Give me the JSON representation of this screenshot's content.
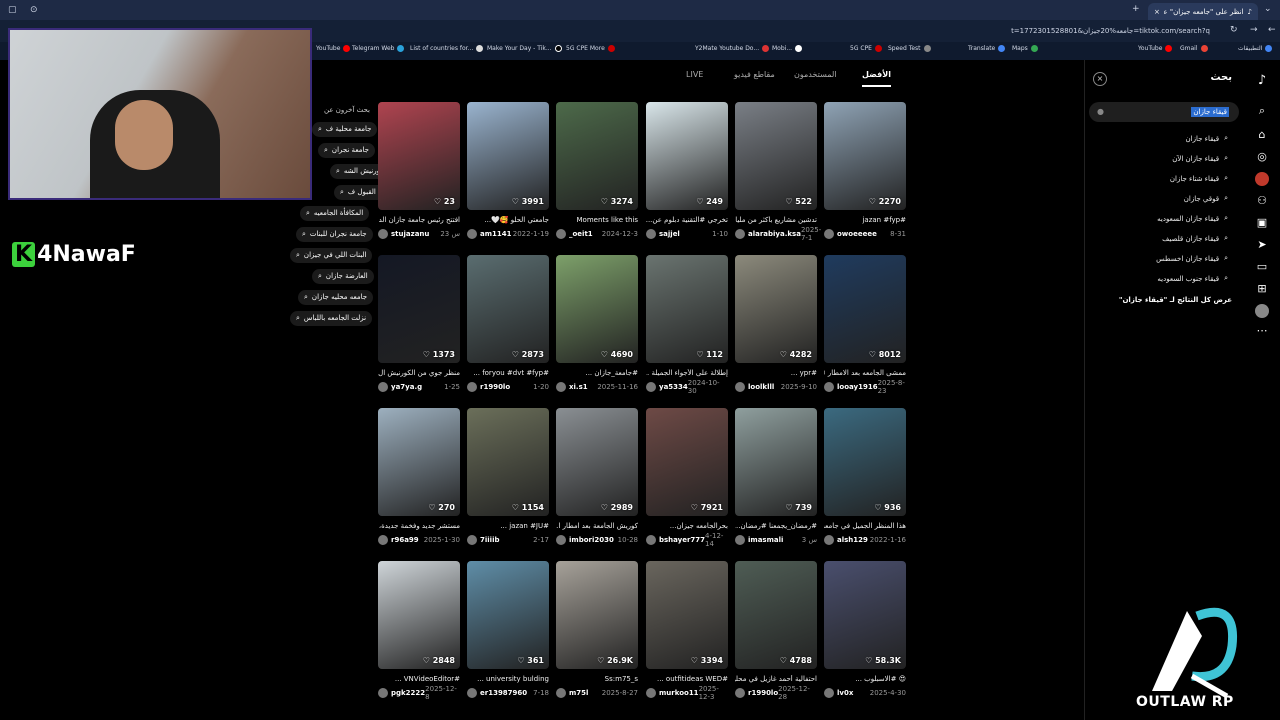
{
  "browser": {
    "tab_title": "انظر على \"جامعه جيزان\" على...",
    "url": "tiktok.com/search?q=جامعه%20جيزان&t=1772301528801",
    "bookmarks": [
      "التطبيقات",
      "Gmail",
      "YouTube",
      "Maps",
      "Translate",
      "Speed Test",
      "5G CPE",
      "Mobi...",
      "Y2Mate Youtube Do...",
      "5G CPE More",
      "Make Your Day - Tik...",
      "List of countries for...",
      "Telegram Web",
      "YouTube"
    ]
  },
  "streamer": {
    "logo_letter": "K",
    "logo_text": "4NawaF",
    "brand": "OUTLAW RP"
  },
  "search_panel": {
    "title": "بحث",
    "query": "قيقاء جازان",
    "suggestions": [
      "قيقاء جازان",
      "قيقاء جازان الآن",
      "قيقاء شتاء جازان",
      "قوقي جازان",
      "قيقاء جازان السعوديه",
      "قيقاء جازان قلصيف",
      "قيقاء جازان اخسطس",
      "قيقاء جنوب السعوديه"
    ],
    "view_all": "عرض كل النتائج لـ \"قيقاء جازان\""
  },
  "tabs": [
    "الأفضل",
    "المستخدمون",
    "مقاطع فيديو",
    "LIVE"
  ],
  "related": {
    "title": "بحث آخرون عن",
    "items": [
      "جامعة محلية ف",
      "جامعة نجران",
      "الكورنيش الشه",
      "نسب القبول ف",
      "المكافأة الجامعيه",
      "جامعة نجران للبنات",
      "البنات اللي في جيزان",
      "العارضة جازان",
      "جامعه محليه جازان",
      "نزلت الجامعه باللباس"
    ]
  },
  "videos": [
    {
      "likes": "2270",
      "caption": "#jazan #fyp",
      "user": "owoeeeee",
      "date": "8-31",
      "bg": "#8fa3b5"
    },
    {
      "likes": "522",
      "caption": "تدشين مشاريع بأكثر من مليار...",
      "user": "alarabiya.ksa",
      "date": "2025-7-1",
      "bg": "#7a7f86"
    },
    {
      "likes": "249",
      "caption": "تخرجي #التقنية دبلوم عن...",
      "user": "sajjel",
      "date": "1-10",
      "bg": "#d9e6ea"
    },
    {
      "likes": "3274",
      "caption": "Moments like this",
      "user": "_oeit1",
      "date": "2024-12-3",
      "bg": "#4d6a4a"
    },
    {
      "likes": "3991",
      "caption": "جامعتي الحلو 🥰🤍...",
      "user": "am1141",
      "date": "2022-1-19",
      "bg": "#9ab4cf"
    },
    {
      "likes": "23",
      "caption": "افتتح رئيس جامعة جازان الد...",
      "user": "stujazanu",
      "date": "23 س",
      "bg": "#b04450"
    },
    {
      "likes": "8012",
      "caption": "ممشى الجامعه بعد الامطار 😍",
      "user": "looay1916",
      "date": "2025-8-23",
      "bg": "#1f3b5e"
    },
    {
      "likes": "4282",
      "caption": "#ypr ...",
      "user": "loolklll",
      "date": "2025-9-10",
      "bg": "#8c8a7c"
    },
    {
      "likes": "112",
      "caption": "إطلالة على الأجواء الجميلة ...",
      "user": "ya5334",
      "date": "2024-10-30",
      "bg": "#6a7470"
    },
    {
      "likes": "4690",
      "caption": "#جامعة_جازان ...",
      "user": "xi.s1",
      "date": "2025-11-16",
      "bg": "#7da06a"
    },
    {
      "likes": "2873",
      "caption": "#foryou #dvt #fyp ...",
      "user": "r1990lo",
      "date": "1-20",
      "bg": "#5a6d70"
    },
    {
      "likes": "1373",
      "caption": "منظر جوي من الكورنيش ال...",
      "user": "ya7ya.g",
      "date": "1-25",
      "bg": "#141824"
    },
    {
      "likes": "936",
      "caption": "هذا المنظر الجميل في جامعة...",
      "user": "alsh129",
      "date": "2022-1-16",
      "bg": "#3b6a80"
    },
    {
      "likes": "739",
      "caption": "#رمضان_يجمعنا #رمضان...",
      "user": "imasmali",
      "date": "3 س",
      "bg": "#8f9f9e"
    },
    {
      "likes": "7921",
      "caption": "بحرالجامعه جيزان...",
      "user": "bshayer777",
      "date": "4-12-14",
      "bg": "#6e4a46"
    },
    {
      "likes": "2989",
      "caption": "كوريش الجامعة بعد امطار ا...",
      "user": "imbori2030",
      "date": "10-28",
      "bg": "#8a8f93"
    },
    {
      "likes": "1154",
      "caption": "#jazan #JU ...",
      "user": "7iiiib",
      "date": "2-17",
      "bg": "#6b6f5a"
    },
    {
      "likes": "270",
      "caption": "مستشر جديد وفخمة جديدة، الن...",
      "user": "r96a99",
      "date": "2025-1-30",
      "bg": "#9db0bf"
    },
    {
      "likes": "58.3K",
      "caption": "😍 #الاسبلوب ...",
      "user": "lv0x",
      "date": "2025-4-30",
      "bg": "#4a4f6e"
    },
    {
      "likes": "4788",
      "caption": "احتفالية أحمد غازيل في محليه ...",
      "user": "r1990lo",
      "date": "2025-12-28",
      "bg": "#4f5d55"
    },
    {
      "likes": "3394",
      "caption": "#outfitideas WED ...",
      "user": "murkoo11",
      "date": "2025-12-3",
      "bg": "#6a665e"
    },
    {
      "likes": "26.9K",
      "caption": "Ss:m75_s",
      "user": "m75l",
      "date": "2025-8-27",
      "bg": "#a7a29a"
    },
    {
      "likes": "361",
      "caption": "university bulding ...",
      "user": "er13987960",
      "date": "7-18",
      "bg": "#5f8ea8"
    },
    {
      "likes": "2848",
      "caption": "#VNVideoEditor ...",
      "user": "pgk2222",
      "date": "2025-12-8",
      "bg": "#cfd5d9"
    }
  ]
}
